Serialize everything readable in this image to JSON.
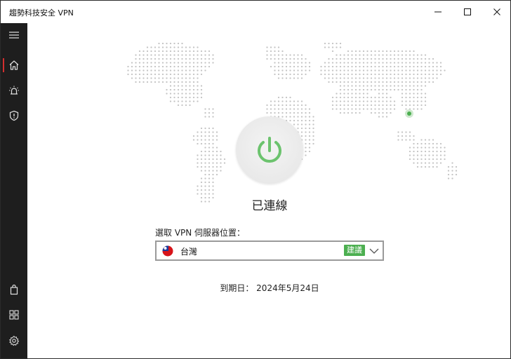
{
  "window": {
    "title": "趨勢科技安全 VPN"
  },
  "window_controls": {
    "minimize": "minimize-icon",
    "maximize": "maximize-icon",
    "close": "close-icon"
  },
  "sidebar": {
    "items": [
      {
        "icon": "menu-icon",
        "active": false
      },
      {
        "icon": "home-icon",
        "active": true
      },
      {
        "icon": "alert-bell-icon",
        "active": false
      },
      {
        "icon": "shield-icon",
        "active": false
      },
      {
        "icon": "shopping-bag-icon",
        "active": false
      },
      {
        "icon": "grid-apps-icon",
        "active": false
      },
      {
        "icon": "gear-icon",
        "active": false
      }
    ]
  },
  "main": {
    "status": "已連線",
    "select_label": "選取 VPN 伺服器位置：",
    "selected_server": "台灣",
    "recommended_badge": "建議",
    "expiry": "到期日： 2024年5月24日"
  },
  "colors": {
    "accent_green": "#4caf50",
    "power_green": "#6cc36e",
    "sidebar_bg": "#1e1e1e",
    "active_indicator": "#d32f2f",
    "map_dot": "#c4c4c4"
  }
}
